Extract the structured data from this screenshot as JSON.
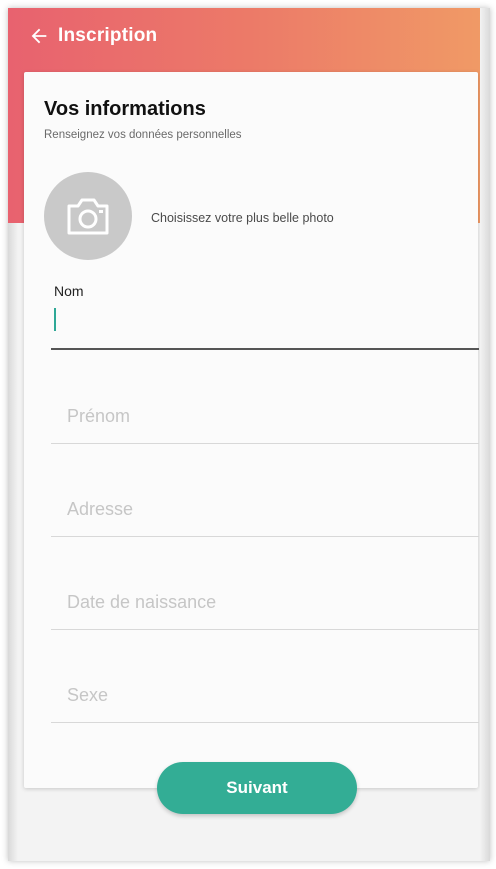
{
  "header": {
    "title": "Inscription",
    "back_icon": "arrow-left-icon",
    "gradient_colors": [
      "#e8626f",
      "#f09b66"
    ]
  },
  "card": {
    "title": "Vos informations",
    "subtitle": "Renseignez vos données personnelles",
    "photo": {
      "icon": "camera-icon",
      "label": "Choisissez votre plus belle photo"
    },
    "fields": {
      "nom": {
        "label": "Nom",
        "value": ""
      },
      "prenom": {
        "placeholder": "Prénom"
      },
      "adresse": {
        "placeholder": "Adresse"
      },
      "date_naissance": {
        "placeholder": "Date de naissance"
      },
      "sexe": {
        "placeholder": "Sexe"
      }
    }
  },
  "actions": {
    "next_label": "Suivant",
    "accent_color": "#33ad95"
  }
}
